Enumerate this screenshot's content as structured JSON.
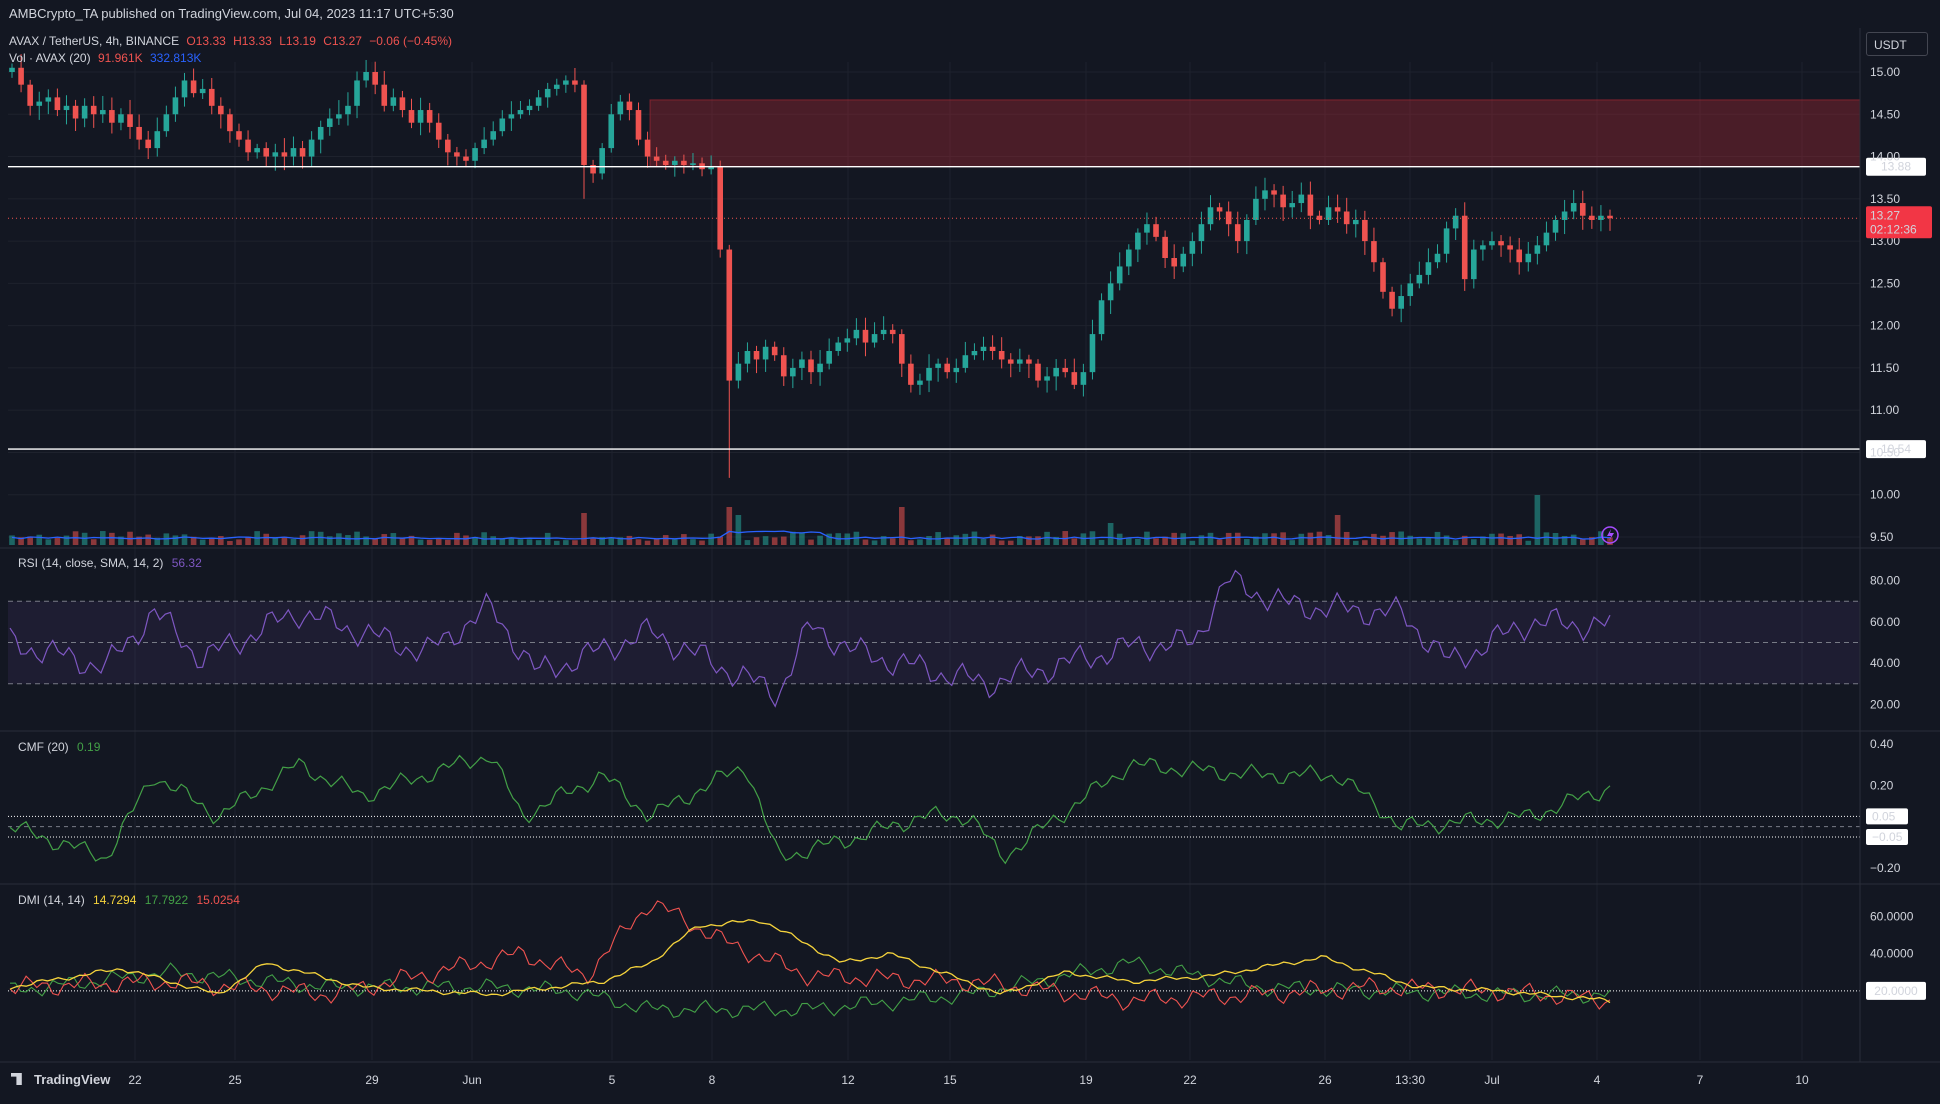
{
  "publisher": "AMBCrypto_TA published on TradingView.com, Jul 04, 2023 11:17 UTC+5:30",
  "symbol": {
    "title": "AVAX / TetherUS, 4h, BINANCE",
    "open": "O13.33",
    "high": "H13.33",
    "low": "L13.19",
    "close": "C13.27",
    "change": "−0.06 (−0.45%)",
    "vol_label": "Vol · AVAX (20)",
    "vol_value": "91.961K",
    "vol_ma": "332.813K"
  },
  "currency_label": "USDT",
  "price_axis": {
    "min": 9.5,
    "max": 15.0,
    "ticks": [
      "15.00",
      "14.50",
      "14.00",
      "13.50",
      "13.00",
      "12.50",
      "12.00",
      "11.50",
      "11.00",
      "10.50",
      "10.00",
      "9.50"
    ]
  },
  "levels": [
    {
      "value": 13.88,
      "label": "13.88"
    },
    {
      "value": 10.54,
      "label": "10.54"
    }
  ],
  "supply_zone": {
    "low": 13.88,
    "high": 14.67
  },
  "last_price": {
    "price": "13.27",
    "countdown": "02:12:36"
  },
  "time_axis": [
    "22",
    "25",
    "29",
    "Jun",
    "5",
    "8",
    "12",
    "15",
    "19",
    "22",
    "26",
    "13:30",
    "Jul",
    "4",
    "7",
    "10"
  ],
  "colors": {
    "up": "#26a69a",
    "down": "#ef5350",
    "background": "#131722",
    "rsi": "#7e57c2",
    "cmf": "#43a047",
    "adx": "#f5d33c",
    "di_plus": "#43a047",
    "di_minus": "#ef5350",
    "vol_ma": "#2962ff"
  },
  "rsi": {
    "title": "RSI (14, close, SMA, 14, 2)",
    "value": "56.32",
    "ticks": [
      "80.00",
      "60.00",
      "40.00",
      "20.00"
    ],
    "upper": 70,
    "lower": 30
  },
  "cmf": {
    "title": "CMF (20)",
    "value": "0.19",
    "ticks": [
      "0.40",
      "0.20",
      "−0.20"
    ],
    "levels": [
      "0.05",
      "−0.05"
    ]
  },
  "dmi": {
    "title": "DMI (14, 14)",
    "adx": "14.7294",
    "di_plus": "17.7922",
    "di_minus": "15.0254",
    "ticks": [
      "60.0000",
      "40.0000"
    ],
    "level": "20.0000"
  },
  "branding": "TradingView",
  "chart_data": {
    "type": "candlestick",
    "title": "AVAX / TetherUS, 4h, BINANCE",
    "ylim": [
      9.5,
      15.0
    ],
    "closes": [
      15.05,
      14.85,
      14.6,
      14.65,
      14.7,
      14.55,
      14.6,
      14.45,
      14.6,
      14.5,
      14.55,
      14.4,
      14.5,
      14.35,
      14.2,
      14.1,
      14.3,
      14.5,
      14.7,
      14.9,
      14.75,
      14.8,
      14.6,
      14.5,
      14.3,
      14.2,
      14.05,
      14.1,
      14.0,
      14.05,
      14.0,
      14.1,
      14.0,
      14.2,
      14.35,
      14.45,
      14.5,
      14.6,
      14.9,
      15.0,
      14.85,
      14.6,
      14.7,
      14.55,
      14.4,
      14.55,
      14.4,
      14.2,
      14.05,
      14.0,
      13.95,
      14.1,
      14.2,
      14.3,
      14.45,
      14.5,
      14.55,
      14.6,
      14.7,
      14.8,
      14.85,
      14.9,
      14.85,
      13.9,
      13.8,
      14.1,
      14.5,
      14.65,
      14.55,
      14.2,
      14.0,
      13.95,
      13.9,
      13.95,
      13.9,
      13.92,
      13.85,
      13.88,
      12.9,
      11.35,
      11.55,
      11.7,
      11.6,
      11.75,
      11.65,
      11.4,
      11.5,
      11.6,
      11.45,
      11.55,
      11.7,
      11.8,
      11.85,
      11.95,
      11.8,
      11.9,
      11.95,
      11.9,
      11.55,
      11.3,
      11.35,
      11.5,
      11.55,
      11.45,
      11.5,
      11.65,
      11.7,
      11.75,
      11.7,
      11.6,
      11.55,
      11.6,
      11.55,
      11.35,
      11.4,
      11.5,
      11.45,
      11.3,
      11.45,
      11.9,
      12.3,
      12.5,
      12.7,
      12.9,
      13.1,
      13.2,
      13.05,
      12.8,
      12.7,
      12.85,
      13.0,
      13.2,
      13.4,
      13.35,
      13.2,
      13.0,
      13.25,
      13.5,
      13.6,
      13.55,
      13.4,
      13.45,
      13.55,
      13.3,
      13.25,
      13.4,
      13.35,
      13.2,
      13.25,
      13.0,
      12.75,
      12.4,
      12.2,
      12.35,
      12.5,
      12.6,
      12.75,
      12.85,
      13.15,
      13.3,
      12.55,
      12.9,
      12.95,
      13.0,
      12.95,
      12.9,
      12.75,
      12.85,
      12.95,
      13.1,
      13.25,
      13.35,
      13.45,
      13.3,
      13.25,
      13.3,
      13.27
    ],
    "indicators": [
      "Volume (20)",
      "RSI (14)",
      "CMF (20)",
      "DMI (14,14)"
    ]
  }
}
